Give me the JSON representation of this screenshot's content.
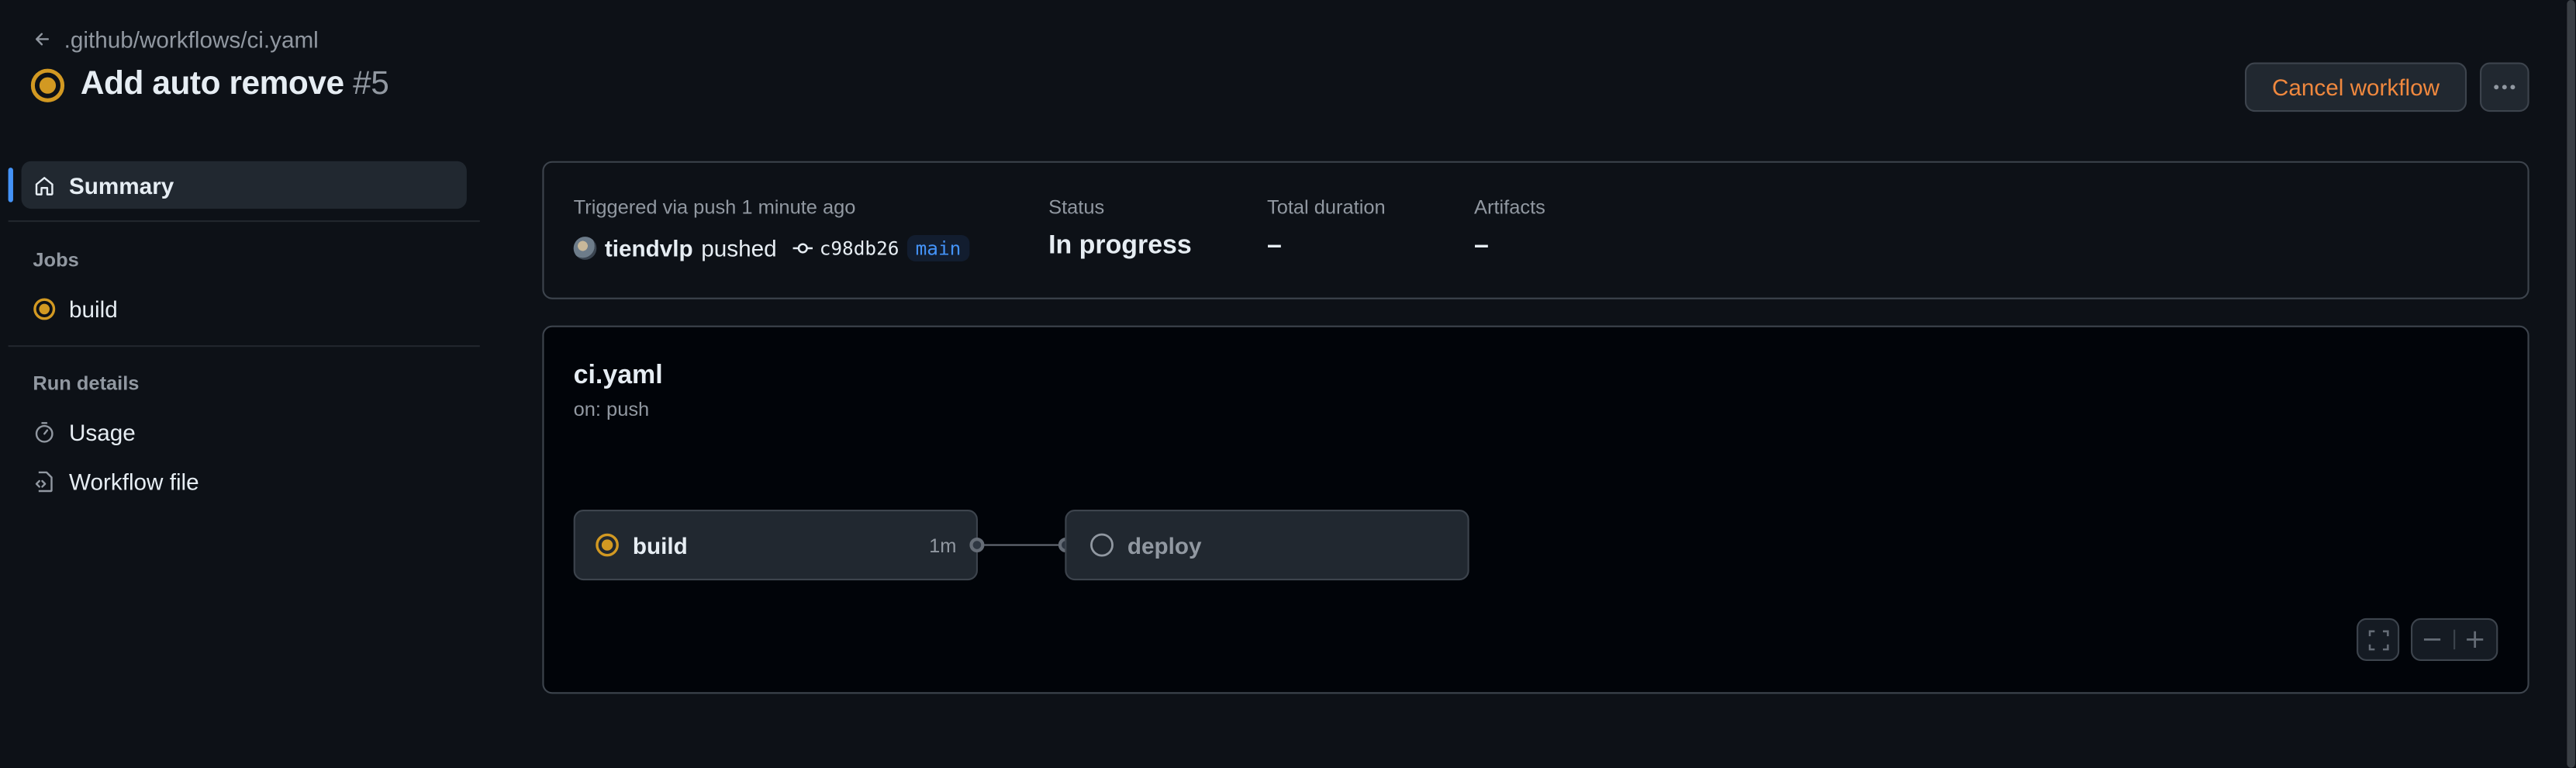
{
  "header": {
    "back_link": ".github/workflows/ci.yaml",
    "title": "Add auto remove",
    "run_number": "#5",
    "cancel_label": "Cancel workflow",
    "more_label": "···"
  },
  "sidebar": {
    "summary": "Summary",
    "jobs_heading": "Jobs",
    "jobs": [
      {
        "label": "build",
        "status": "in-progress"
      }
    ],
    "run_details_heading": "Run details",
    "details": [
      {
        "label": "Usage",
        "icon": "stopwatch-icon"
      },
      {
        "label": "Workflow file",
        "icon": "file-code-icon"
      }
    ]
  },
  "summary": {
    "trigger": "Triggered via push 1 minute ago",
    "user": "tiendvlp",
    "action": "pushed",
    "commit": "c98db26",
    "branch": "main",
    "status_label": "Status",
    "status_value": "In progress",
    "duration_label": "Total duration",
    "duration_value": "–",
    "artifacts_label": "Artifacts",
    "artifacts_value": "–"
  },
  "graph": {
    "file": "ci.yaml",
    "on": "on: push",
    "jobs": [
      {
        "name": "build",
        "time": "1m",
        "status": "in-progress"
      },
      {
        "name": "deploy",
        "time": "",
        "status": "pending"
      }
    ]
  },
  "colors": {
    "background": "#0d1117",
    "in_progress": "#d29922",
    "accent_blue": "#4493f8",
    "cancel_orange": "#f0883e"
  }
}
